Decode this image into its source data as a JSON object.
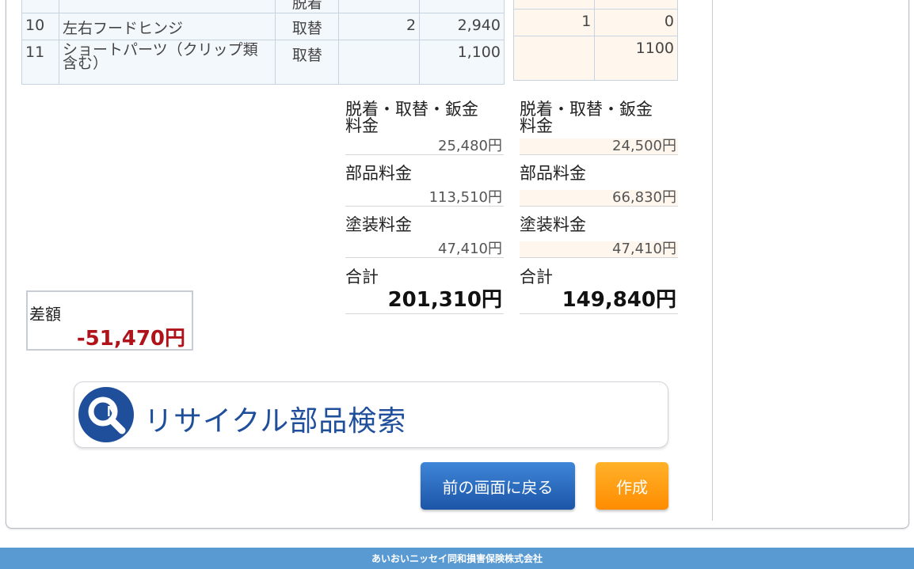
{
  "parts_table": {
    "rows": [
      {
        "no": "",
        "name": "",
        "op": "脱着",
        "qty": "",
        "price": "",
        "r_qty": "",
        "r_price": ""
      },
      {
        "no": "10",
        "name": "左右フードヒンジ",
        "op": "取替",
        "qty": "2",
        "price": "2,940",
        "r_qty": "1",
        "r_price": "0"
      },
      {
        "no": "11",
        "name": "ショートパーツ（クリップ類含む）",
        "op": "取替",
        "qty": "",
        "price": "1,100",
        "r_qty": "",
        "r_price": "1100"
      }
    ]
  },
  "summary_left": {
    "labor_label": "脱着・取替・鈑金料金",
    "labor_value": "25,480円",
    "parts_label": "部品料金",
    "parts_value": "113,510円",
    "paint_label": "塗装料金",
    "paint_value": "47,410円",
    "total_label": "合計",
    "total_value": "201,310円"
  },
  "summary_right": {
    "labor_label": "脱着・取替・鈑金料金",
    "labor_value": "24,500円",
    "parts_label": "部品料金",
    "parts_value": "66,830円",
    "paint_label": "塗装料金",
    "paint_value": "47,410円",
    "total_label": "合計",
    "total_value": "149,840円"
  },
  "difference": {
    "label": "差額",
    "value": "-51,470円",
    "color": "#b0121a"
  },
  "recycle_search": {
    "label": "リサイクル部品検索",
    "icon": "search-magnifier-icon",
    "color": "#1f4f9b"
  },
  "buttons": {
    "back_label": "前の画面に戻る",
    "create_label": "作成"
  },
  "footer": {
    "company": "あいおいニッセイ同和損害保険株式会社"
  }
}
